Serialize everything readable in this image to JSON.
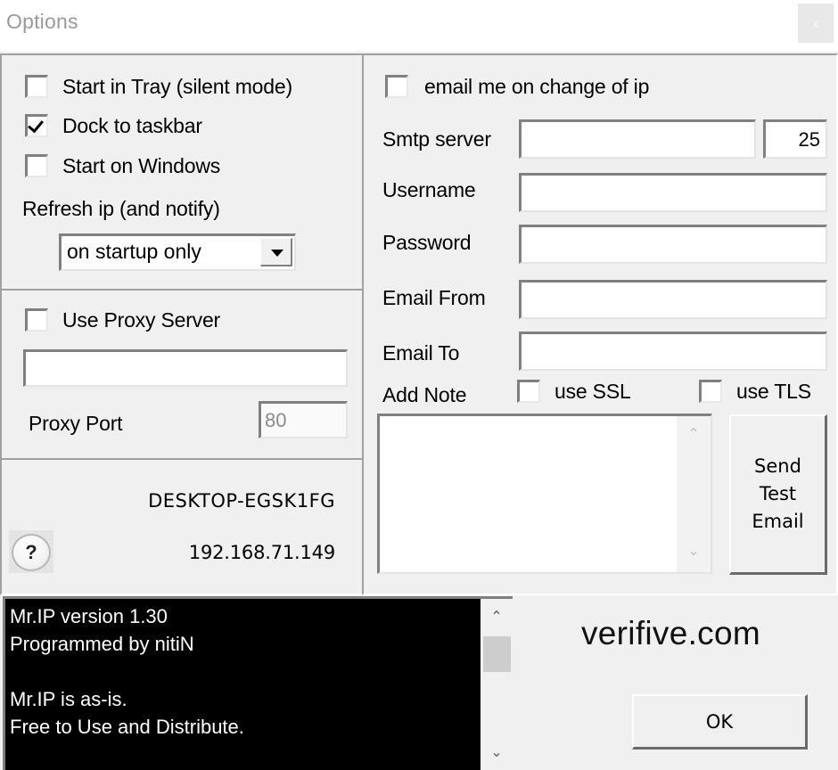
{
  "window": {
    "title": "Options",
    "close_glyph": "x"
  },
  "startup": {
    "start_in_tray": {
      "label": "Start in Tray (silent mode)",
      "checked": false
    },
    "dock_to_taskbar": {
      "label": "Dock to taskbar",
      "checked": true
    },
    "start_on_windows": {
      "label": "Start on Windows",
      "checked": false
    },
    "refresh_label": "Refresh ip (and notify)",
    "refresh_select": {
      "value": "on startup only"
    }
  },
  "proxy": {
    "use_proxy": {
      "label": "Use Proxy Server",
      "checked": false
    },
    "server_value": "",
    "port_label": "Proxy Port",
    "port_value": "80"
  },
  "info": {
    "hostname": "DESKTOP-EGSK1FG",
    "ip": "192.168.71.149",
    "help_glyph": "?"
  },
  "email": {
    "notify": {
      "label": "email me on change of ip",
      "checked": false
    },
    "smtp_label": "Smtp server",
    "smtp_value": "",
    "smtp_port": "25",
    "username_label": "Username",
    "username_value": "",
    "password_label": "Password",
    "password_value": "",
    "from_label": "Email From",
    "from_value": "",
    "to_label": "Email To",
    "to_value": "",
    "note_label": "Add Note",
    "note_value": "",
    "use_ssl": {
      "label": "use SSL",
      "checked": false
    },
    "use_tls": {
      "label": "use TLS",
      "checked": false
    },
    "send_test_label": "Send\nTest\nEmail"
  },
  "console": {
    "text": "Mr.IP version 1.30\nProgrammed by nitiN\n\nMr.IP is as-is.\nFree to Use and Distribute."
  },
  "footer": {
    "brand": "verifive.com",
    "ok_label": "OK"
  },
  "icons": {
    "chevron_up": "⌃",
    "chevron_down": "⌄"
  }
}
